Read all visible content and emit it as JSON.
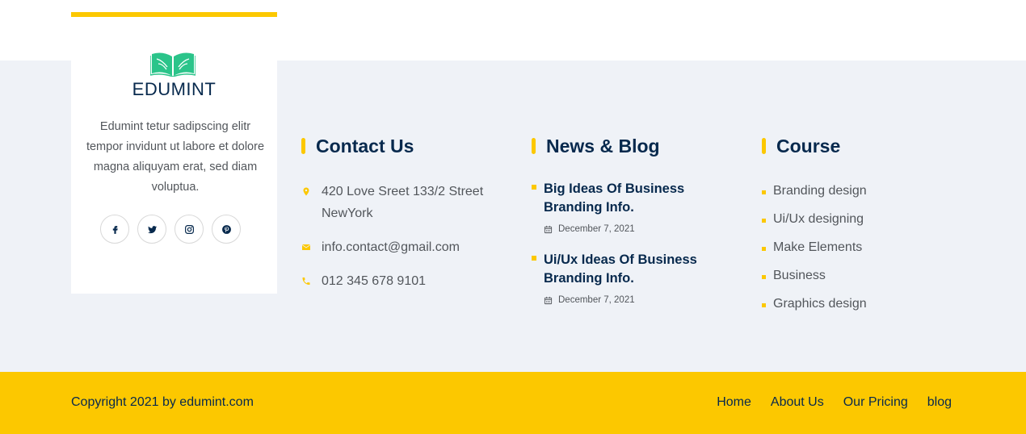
{
  "brand": {
    "name": "EDUMINT",
    "description": "Edumint tetur sadipscing elitr tempor invidunt ut labore et dolore magna aliquyam erat, sed diam voluptua.",
    "accent_color": "#fcc800",
    "logo_color": "#2bc48a",
    "social": [
      {
        "name": "facebook",
        "icon": "facebook-icon"
      },
      {
        "name": "twitter",
        "icon": "twitter-icon"
      },
      {
        "name": "instagram",
        "icon": "instagram-icon"
      },
      {
        "name": "pinterest",
        "icon": "pinterest-icon"
      }
    ]
  },
  "contact": {
    "title": "Contact Us",
    "address_line1": "420 Love Sreet 133/2 Street",
    "address_line2": "NewYork",
    "email": "info.contact@gmail.com",
    "phone": "012 345 678 9101"
  },
  "news": {
    "title": "News & Blog",
    "items": [
      {
        "line1": "Big Ideas Of Business",
        "line2": "Branding Info.",
        "date": "December 7, 2021"
      },
      {
        "line1": "Ui/Ux Ideas Of Business",
        "line2": "Branding Info.",
        "date": "December 7, 2021"
      }
    ]
  },
  "course": {
    "title": "Course",
    "items": [
      "Branding design",
      "Ui/Ux designing",
      "Make Elements",
      "Business",
      "Graphics design"
    ]
  },
  "bottom": {
    "copyright": "Copyright 2021 by edumint.com",
    "nav": [
      "Home",
      "About Us",
      "Our Pricing",
      "blog"
    ]
  }
}
